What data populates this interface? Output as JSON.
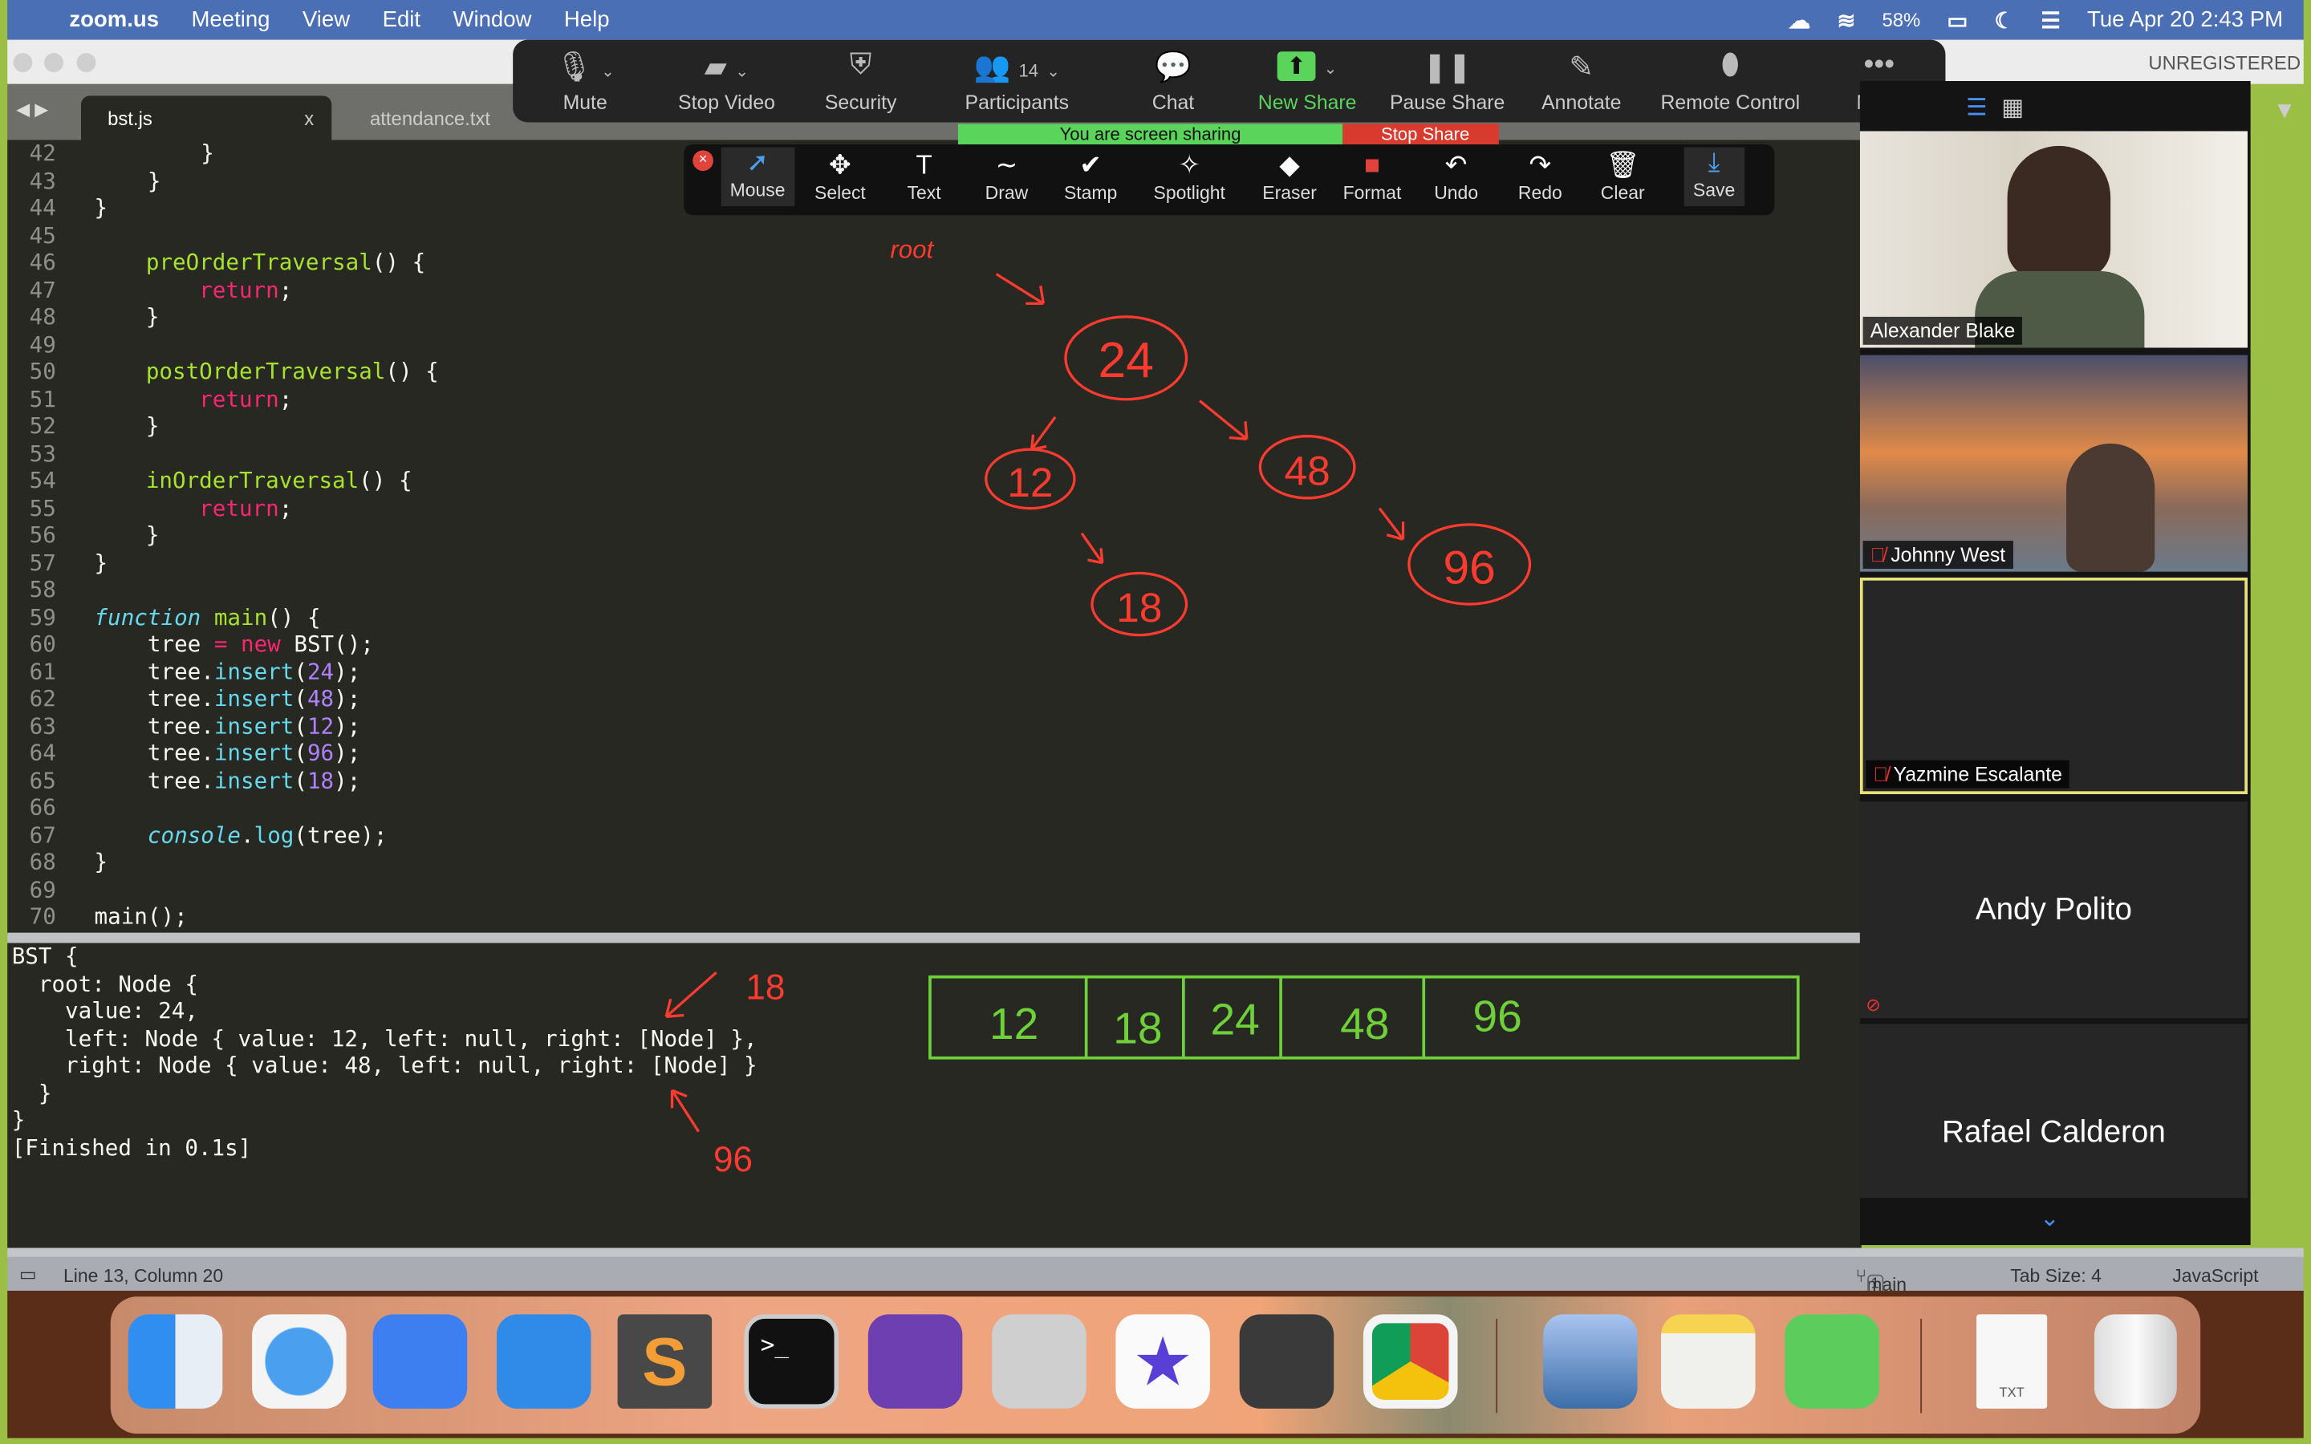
{
  "menubar": {
    "app": "zoom.us",
    "items": [
      "Meeting",
      "View",
      "Edit",
      "Window",
      "Help"
    ],
    "battery": "58%",
    "datetime": "Tue Apr 20  2:43 PM"
  },
  "window": {
    "unregistered": "UNREGISTERED"
  },
  "tabs": [
    {
      "label": "bst.js",
      "close": "x"
    },
    {
      "label": "attendance.txt"
    }
  ],
  "zoom_toolbar": [
    {
      "label": "Mute",
      "icon": "mic-icon"
    },
    {
      "label": "Stop Video",
      "icon": "video-icon"
    },
    {
      "label": "Security",
      "icon": "shield-icon"
    },
    {
      "label": "Participants",
      "icon": "participants-icon",
      "count": "14"
    },
    {
      "label": "Chat",
      "icon": "chat-icon"
    },
    {
      "label": "New Share",
      "icon": "share-icon"
    },
    {
      "label": "Pause Share",
      "icon": "pause-icon"
    },
    {
      "label": "Annotate",
      "icon": "pen-icon"
    },
    {
      "label": "Remote Control",
      "icon": "mouse-icon"
    },
    {
      "label": "More",
      "icon": "more-icon"
    }
  ],
  "share_banner": {
    "text": "You are screen sharing",
    "stop": "Stop Share"
  },
  "annotate_toolbar": [
    {
      "label": "Mouse",
      "icon": "➚"
    },
    {
      "label": "Select",
      "icon": "✥"
    },
    {
      "label": "Text",
      "icon": "T"
    },
    {
      "label": "Draw",
      "icon": "∼"
    },
    {
      "label": "Stamp",
      "icon": "✔"
    },
    {
      "label": "Spotlight",
      "icon": "✧"
    },
    {
      "label": "Eraser",
      "icon": "◆"
    },
    {
      "label": "Format",
      "icon": "■"
    },
    {
      "label": "Undo",
      "icon": "↶"
    },
    {
      "label": "Redo",
      "icon": "↷"
    },
    {
      "label": "Clear",
      "icon": "🗑"
    },
    {
      "label": "Save",
      "icon": "⤓"
    }
  ],
  "code": {
    "lines": [
      "42",
      "43",
      "44",
      "45",
      "46",
      "47",
      "48",
      "49",
      "50",
      "51",
      "52",
      "53",
      "54",
      "55",
      "56",
      "57",
      "58",
      "59",
      "60",
      "61",
      "62",
      "63",
      "64",
      "65",
      "66",
      "67",
      "68",
      "69",
      "70"
    ]
  },
  "tokens": {
    "pre": "preOrderTraversal",
    "post": "postOrderTraversal",
    "in": "inOrderTraversal",
    "ret": "return",
    "fn": "function",
    "main": "main",
    "tree": "tree",
    "new": "new",
    "bst": "BST",
    "insert": "insert",
    "console": "console",
    "log": "log",
    "nums": [
      "24",
      "48",
      "12",
      "96",
      "18"
    ]
  },
  "output": "BST {\n  root: Node {\n    value: 24,\n    left: Node { value: 12, left: null, right: [Node] },\n    right: Node { value: 48, left: null, right: [Node] }\n  }\n}\n[Finished in 0.1s]",
  "annotations": {
    "root": "root",
    "tree": [
      "24",
      "12",
      "48",
      "18",
      "96"
    ],
    "output_notes": [
      "18",
      "96"
    ],
    "array": [
      "12",
      "18",
      "24",
      "48",
      "96"
    ]
  },
  "gallery": [
    {
      "name": "Alexander Blake"
    },
    {
      "name": "Johnny West"
    },
    {
      "name": "Yazmine Escalante"
    },
    {
      "name": "Andy Polito"
    },
    {
      "name": "Rafael Calderon"
    }
  ],
  "statusbar": {
    "position": "Line 13, Column 20",
    "branch": "main",
    "branch_count": "1",
    "tab_size": "Tab Size: 4",
    "syntax": "JavaScript"
  },
  "dock": {
    "txt": "TXT"
  }
}
